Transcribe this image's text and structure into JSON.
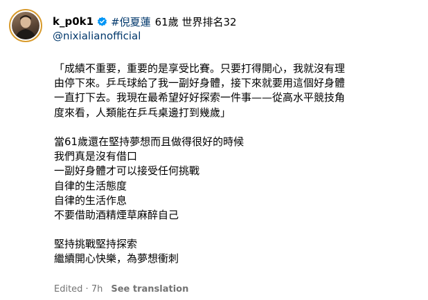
{
  "post": {
    "username": "k_p0k1",
    "verified_icon": "verified-badge-icon",
    "hashtag": "#倪夏蓮",
    "bio": "61歲 世界排名32",
    "mention": "@nixialianofficial",
    "caption_lines": [
      "「成績不重要，重要的是享受比賽。只要打得開心，我就沒有理",
      "由停下來。乒乓球給了我一副好身體，接下來就要用這個好身體",
      "一直打下去。我現在最希望好好探索一件事——從高水平競技角",
      "度來看，人類能在乒乓桌邊打到幾歲」",
      "",
      "當61歲還在堅持夢想而且做得很好的時候",
      "我們真是沒有借口",
      "一副好身體才可以接受任何挑戰",
      "自律的生活態度",
      "自律的生活作息",
      "不要借助酒精煙草麻醉自己",
      "",
      "堅持挑戰堅持探索",
      "繼續開心快樂，為夢想衝刺"
    ],
    "edited_label": "Edited · 7h",
    "see_translation_label": "See translation"
  },
  "colors": {
    "link": "#00376b",
    "verified": "#0095f6",
    "muted": "#737373",
    "avatar_ring": "#d89a2c"
  }
}
